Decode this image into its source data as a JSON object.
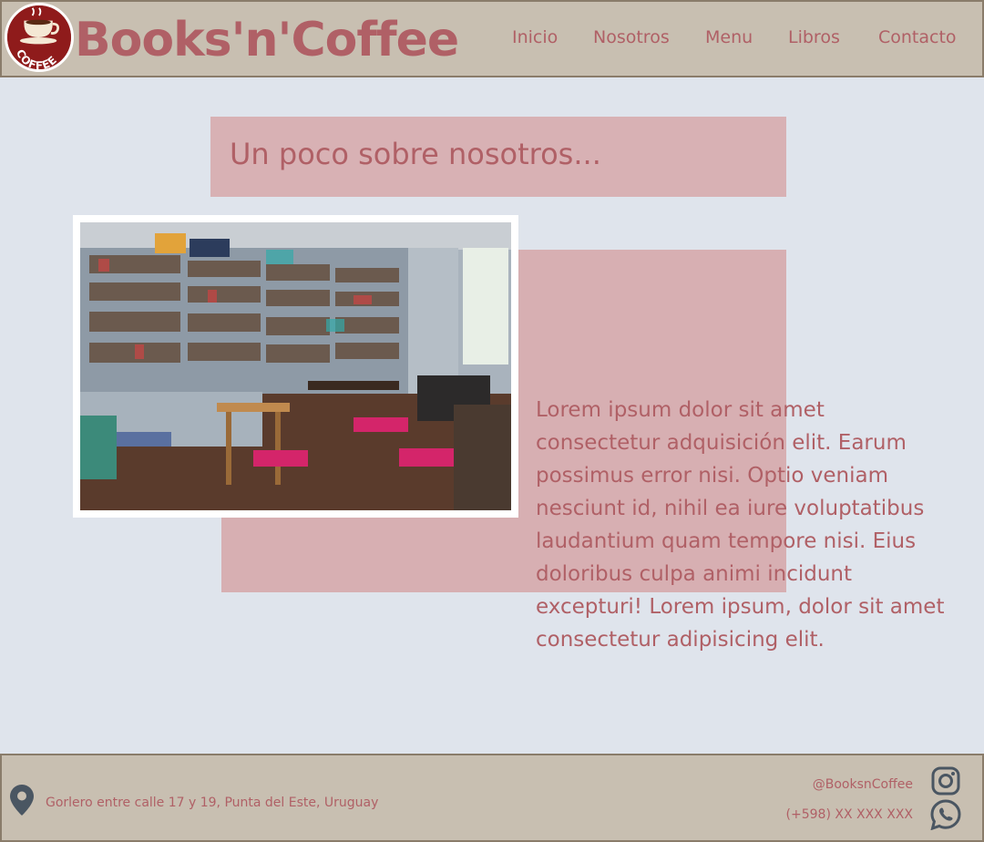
{
  "header": {
    "brand": "Books'n'Coffee",
    "logo_text": "COFFEE",
    "nav": [
      {
        "label": "Inicio"
      },
      {
        "label": "Nosotros"
      },
      {
        "label": "Menu"
      },
      {
        "label": "Libros"
      },
      {
        "label": "Contacto"
      }
    ]
  },
  "about": {
    "title": "Un poco sobre nosotros...",
    "body": "Lorem ipsum dolor sit amet consectetur adquisición elit. Earum possimus error nisi. Optio veniam nesciunt id, nihil ea iure voluptatibus laudantium quam tempore nisi. Eius doloribus culpa animi incidunt excepturi! Lorem ipsum, dolor sit amet consectetur adipisicing elit."
  },
  "footer": {
    "address": "Gorlero entre calle 17 y 19, Punta del Este, Uruguay",
    "instagram": "@BooksnCoffee",
    "phone": "(+598) XX XXX XXX"
  },
  "icons": {
    "location": "map-pin-icon",
    "instagram": "instagram-icon",
    "whatsapp": "whatsapp-icon"
  },
  "colors": {
    "accent": "#b06066",
    "header_bg": "#c8bfb1",
    "page_bg": "#dfe4ec",
    "pink_block": "#d8b1b4",
    "icon": "#4a5662"
  }
}
